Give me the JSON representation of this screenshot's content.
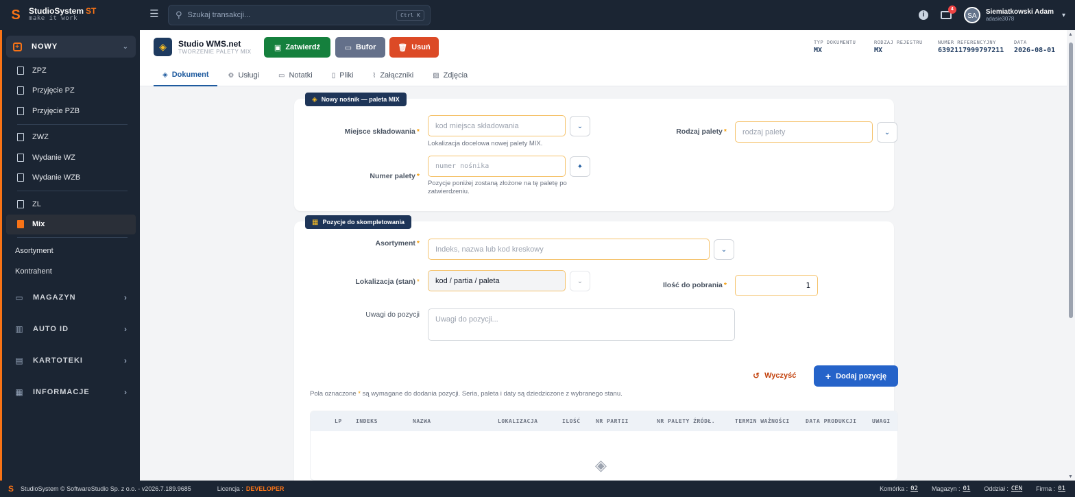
{
  "brand": {
    "name": "StudioSystem",
    "suffix": "ST",
    "tagline": "make it work"
  },
  "search": {
    "placeholder": "Szukaj transakcji...",
    "shortcut": "Ctrl K"
  },
  "user": {
    "name": "Siemiatkowski Adam",
    "login": "adasie3078",
    "notifications": "4"
  },
  "sidebar": {
    "new_section": "NOWY",
    "items": [
      {
        "label": "ZPZ"
      },
      {
        "label": "Przyjęcie PZ"
      },
      {
        "label": "Przyjęcie PZB"
      },
      {
        "label": "ZWZ"
      },
      {
        "label": "Wydanie WZ"
      },
      {
        "label": "Wydanie WZB"
      },
      {
        "label": "ZL"
      },
      {
        "label": "Mix"
      }
    ],
    "plain": [
      "Asortyment",
      "Kontrahent"
    ],
    "sections": [
      "MAGAZYN",
      "AUTO ID",
      "KARTOTEKI",
      "INFORMACJE"
    ]
  },
  "header": {
    "app_title": "Studio WMS.net",
    "app_subtitle": "TWORZENIE PALETY MIX",
    "buttons": {
      "confirm": "Zatwierdź",
      "buffer": "Bufor",
      "delete": "Usuń"
    },
    "meta": [
      {
        "label": "TYP DOKUMENTU",
        "value": "MX"
      },
      {
        "label": "RODZAJ REJESTRU",
        "value": "MX"
      },
      {
        "label": "NUMER REFERENCYJNY",
        "value": "6392117999797211"
      },
      {
        "label": "DATA",
        "value": "2026-08-01"
      }
    ],
    "tabs": [
      "Dokument",
      "Usługi",
      "Notatki",
      "Pliki",
      "Załączniki",
      "Zdjęcia"
    ]
  },
  "form1": {
    "tag": "Nowy nośnik — paleta MIX",
    "storage_label": "Miejsce składowania",
    "storage_placeholder": "kod miejsca składowania",
    "storage_hint": "Lokalizacja docelowa nowej palety MIX.",
    "pallet_type_label": "Rodzaj palety",
    "pallet_type_placeholder": "rodzaj palety",
    "pallet_no_label": "Numer palety",
    "pallet_no_placeholder": "numer nośnika",
    "pallet_no_hint_1": "Pozycje poniżej zostaną złożone na tę paletę po",
    "pallet_no_hint_2": "zatwierdzeniu."
  },
  "form2": {
    "tag": "Pozycje do skompletowania",
    "assortment_label": "Asortyment",
    "assortment_placeholder": "Indeks, nazwa lub kod kreskowy",
    "location_label": "Lokalizacja (stan)",
    "location_value": "kod / partia / paleta",
    "qty_label": "Ilość do pobrania",
    "qty_value": "1",
    "notes_label": "Uwagi do pozycji",
    "notes_placeholder": "Uwagi do pozycji...",
    "clear": "Wyczyść",
    "add": "Dodaj pozycję",
    "footnote_a": "Pola oznaczone ",
    "footnote_b": " są wymagane do dodania pozycji. Seria, paleta i daty są dziedziczone z wybranego stanu."
  },
  "table": {
    "columns": [
      "LP",
      "INDEKS",
      "NAZWA",
      "LOKALIZACJA",
      "ILOŚĆ",
      "NR PARTII",
      "NR PALETY ŹRÓDŁ.",
      "TERMIN WAŻNOŚCI",
      "DATA PRODUKCJI",
      "UWAGI"
    ]
  },
  "footer": {
    "copyright": "StudioSystem © SoftwareStudio Sp. z o.o. - v2026.7.189.9685",
    "license_label": "Licencja :",
    "license_value": "DEVELOPER",
    "cell_label": "Komórka :",
    "cell_value": "02",
    "warehouse_label": "Magazyn :",
    "warehouse_value": "01",
    "branch_label": "Oddział :",
    "branch_value": "CEN",
    "company_label": "Firma :",
    "company_value": "01"
  },
  "colors": {
    "accent": "#f97316",
    "nav_bg": "#1b2533",
    "primary": "#2563c9",
    "confirm": "#15803d",
    "delete": "#dc4a26"
  }
}
